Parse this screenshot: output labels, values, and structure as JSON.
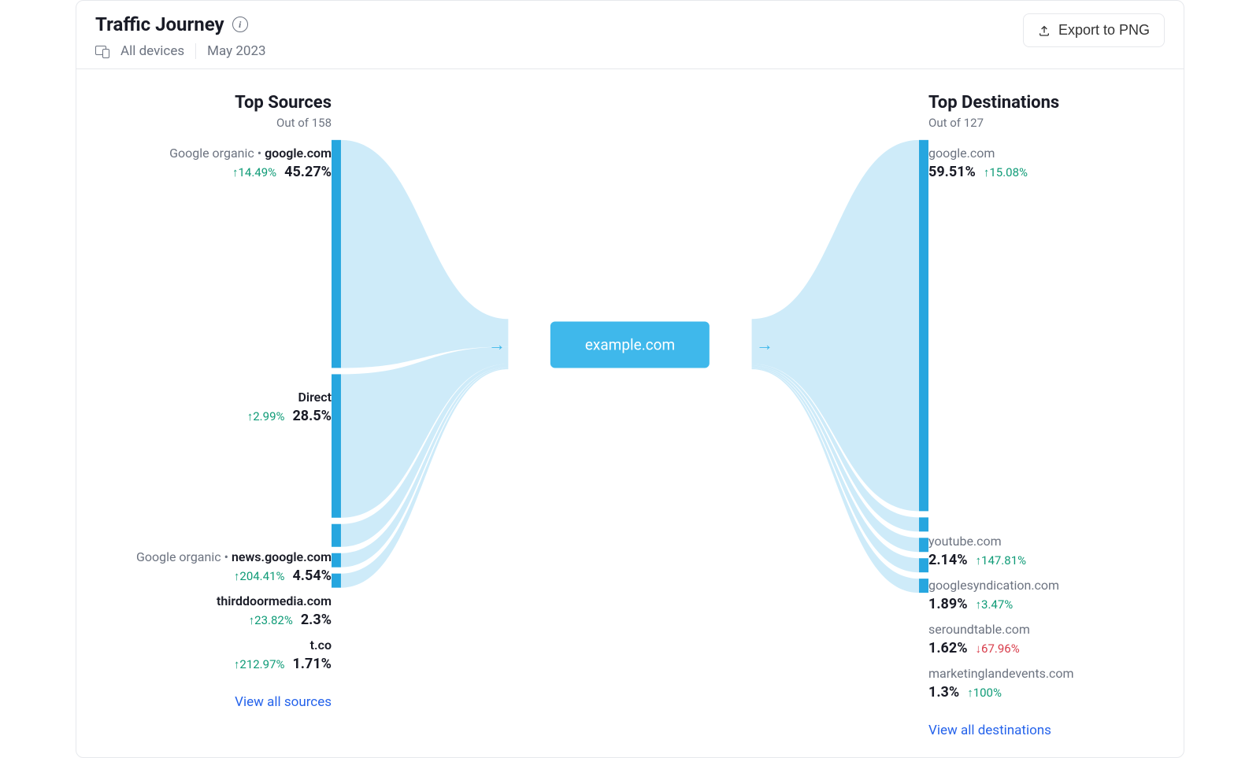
{
  "header": {
    "title": "Traffic Journey",
    "devices": "All devices",
    "period": "May 2023",
    "export_label": "Export to PNG"
  },
  "center_domain": "example.com",
  "sources": {
    "title": "Top Sources",
    "sub_prefix": "Out of ",
    "total": 158,
    "view_all": "View all sources",
    "items": [
      {
        "tag": "Google organic",
        "domain": "google.com",
        "pct": "45.27%",
        "change": "14.49%",
        "dir": "up"
      },
      {
        "tag": "",
        "domain": "Direct",
        "pct": "28.5%",
        "change": "2.99%",
        "dir": "up"
      },
      {
        "tag": "Google organic",
        "domain": "news.google.com",
        "pct": "4.54%",
        "change": "204.41%",
        "dir": "up"
      },
      {
        "tag": "",
        "domain": "thirddoormedia.com",
        "pct": "2.3%",
        "change": "23.82%",
        "dir": "up"
      },
      {
        "tag": "",
        "domain": "t.co",
        "pct": "1.71%",
        "change": "212.97%",
        "dir": "up"
      }
    ]
  },
  "destinations": {
    "title": "Top Destinations",
    "sub_prefix": "Out of ",
    "total": 127,
    "view_all": "View all destinations",
    "items": [
      {
        "domain": "google.com",
        "pct": "59.51%",
        "change": "15.08%",
        "dir": "up"
      },
      {
        "domain": "youtube.com",
        "pct": "2.14%",
        "change": "147.81%",
        "dir": "up"
      },
      {
        "domain": "googlesyndication.com",
        "pct": "1.89%",
        "change": "3.47%",
        "dir": "up"
      },
      {
        "domain": "seroundtable.com",
        "pct": "1.62%",
        "change": "67.96%",
        "dir": "down"
      },
      {
        "domain": "marketinglandevents.com",
        "pct": "1.3%",
        "change": "100%",
        "dir": "up"
      }
    ]
  },
  "chart_data": {
    "type": "sankey",
    "center": "example.com",
    "sources": [
      {
        "label": "google.com",
        "value": 45.27
      },
      {
        "label": "Direct",
        "value": 28.5
      },
      {
        "label": "news.google.com",
        "value": 4.54
      },
      {
        "label": "thirddoormedia.com",
        "value": 2.3
      },
      {
        "label": "t.co",
        "value": 1.71
      }
    ],
    "destinations": [
      {
        "label": "google.com",
        "value": 59.51
      },
      {
        "label": "youtube.com",
        "value": 2.14
      },
      {
        "label": "googlesyndication.com",
        "value": 1.89
      },
      {
        "label": "seroundtable.com",
        "value": 1.62
      },
      {
        "label": "marketinglandevents.com",
        "value": 1.3
      }
    ]
  }
}
